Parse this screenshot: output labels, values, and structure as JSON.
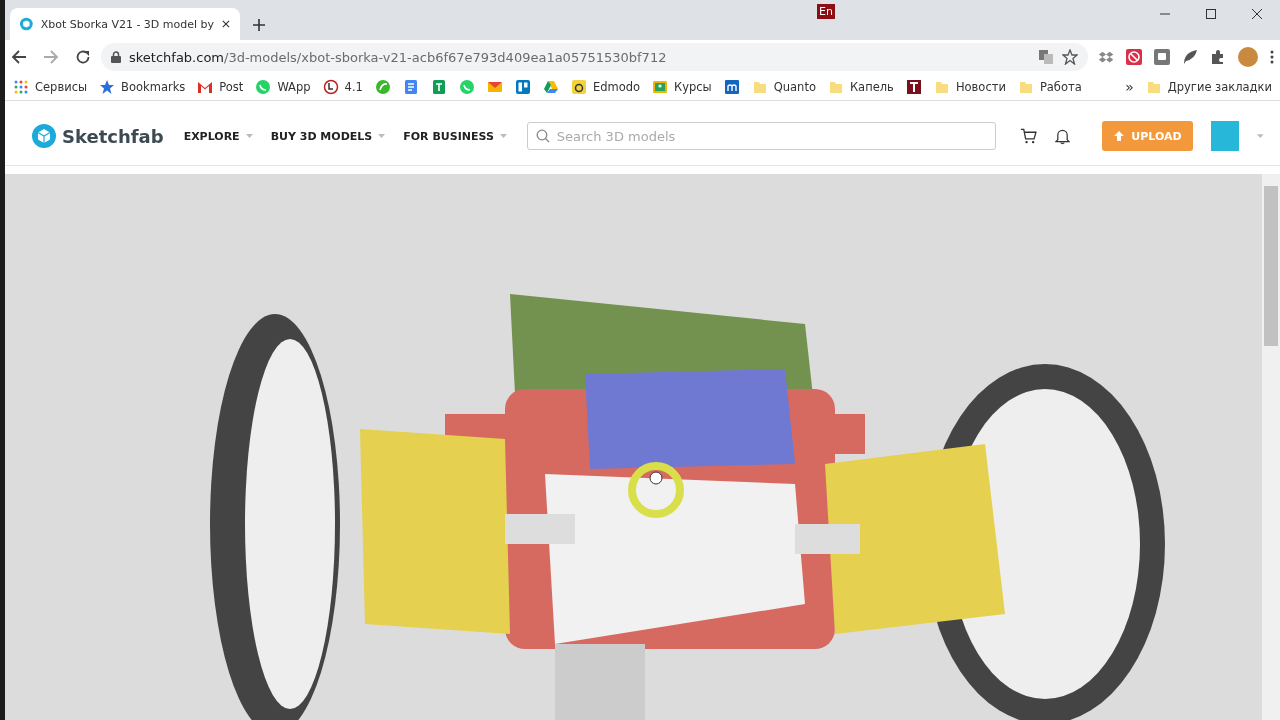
{
  "taskbar": {
    "language": "En"
  },
  "tabs": [
    {
      "title": "Xbot Sborka V21 - 3D model by",
      "selected": true
    }
  ],
  "address_bar": {
    "domain": "sketchfab.com",
    "path": "/3d-models/xbot-sborka-v21-acb6f67e793d409ea1a05751530bf712"
  },
  "bookmarks": [
    {
      "kind": "apps",
      "label": "Сервисы"
    },
    {
      "kind": "star",
      "label": "Bookmarks"
    },
    {
      "kind": "gmail",
      "label": "Post"
    },
    {
      "kind": "chat",
      "label": "WApp"
    },
    {
      "kind": "ring",
      "label": "4.1"
    },
    {
      "kind": "leaf"
    },
    {
      "kind": "doc"
    },
    {
      "kind": "sheet"
    },
    {
      "kind": "chat"
    },
    {
      "kind": "mail"
    },
    {
      "kind": "board"
    },
    {
      "kind": "drive"
    },
    {
      "kind": "edmodo",
      "label": "Edmodo"
    },
    {
      "kind": "classroom",
      "label": "Курсы"
    },
    {
      "kind": "mblock"
    },
    {
      "kind": "folder",
      "label": "Quanto"
    },
    {
      "kind": "folder",
      "label": "Капель"
    },
    {
      "kind": "tblock"
    },
    {
      "kind": "folder",
      "label": "Новости"
    },
    {
      "kind": "folder",
      "label": "Работа"
    }
  ],
  "bookmarks_more": "»",
  "other_bookmarks": "Другие закладки",
  "site": {
    "brand": "Sketchfab",
    "nav": [
      "EXPLORE",
      "BUY 3D MODELS",
      "FOR BUSINESS"
    ],
    "search": {
      "placeholder": "Search 3D models"
    },
    "upload": "UPLOAD"
  }
}
